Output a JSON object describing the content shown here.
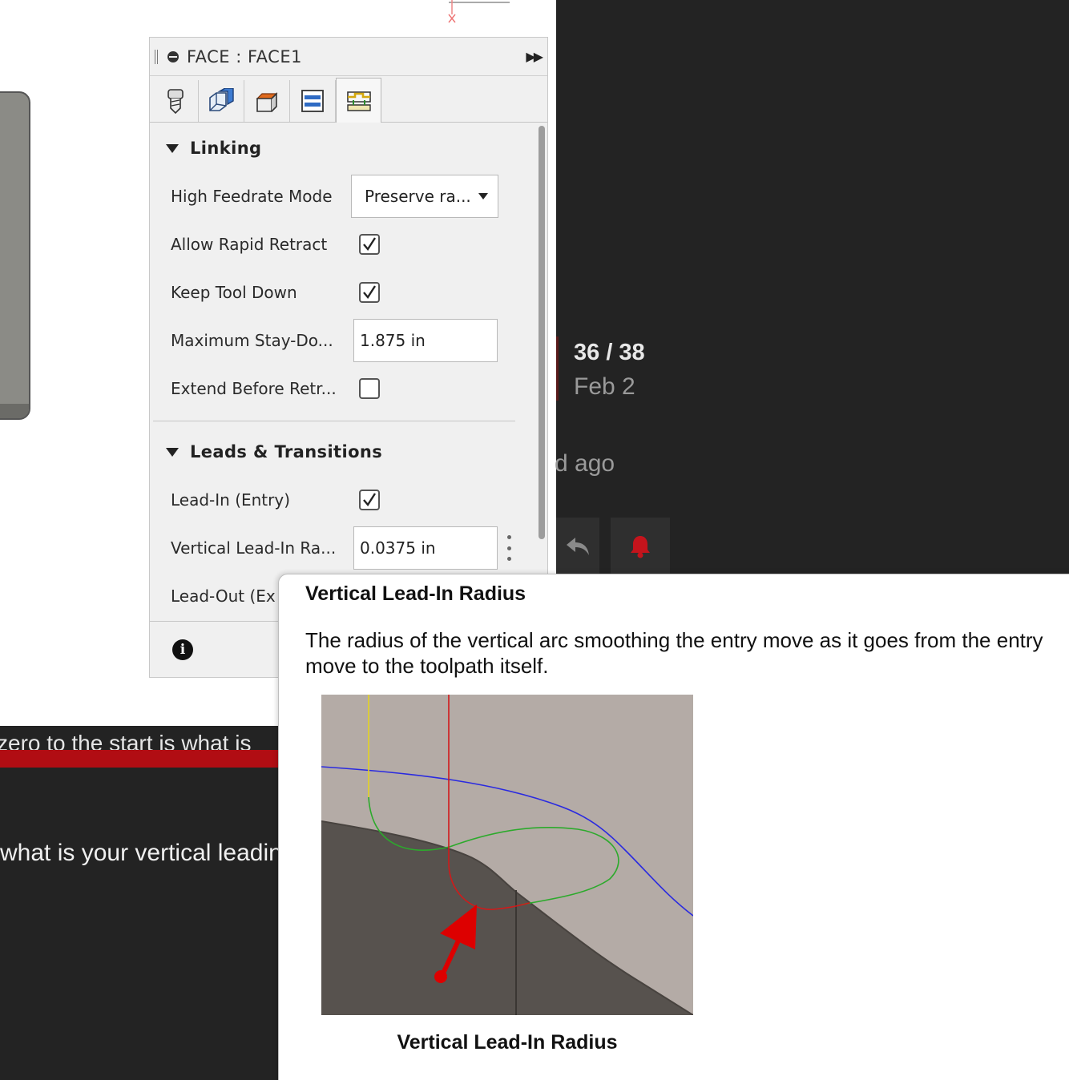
{
  "dialog": {
    "title": "FACE : FACE1",
    "tabs": [
      {
        "icon": "tool-icon",
        "active": false
      },
      {
        "icon": "geometry-icon",
        "active": false
      },
      {
        "icon": "heights-icon",
        "active": false
      },
      {
        "icon": "passes-icon",
        "active": false
      },
      {
        "icon": "linking-icon",
        "active": true
      }
    ],
    "sections": {
      "linking": {
        "title": "Linking",
        "high_feedrate_mode": {
          "label": "High Feedrate Mode",
          "value": "Preserve ra..."
        },
        "allow_rapid_retract": {
          "label": "Allow Rapid Retract",
          "checked": true
        },
        "keep_tool_down": {
          "label": "Keep Tool Down",
          "checked": true
        },
        "max_stay_down": {
          "label": "Maximum Stay-Do...",
          "value": "1.875 in"
        },
        "extend_before_retract": {
          "label": "Extend Before Retr...",
          "checked": false
        }
      },
      "leads": {
        "title": "Leads & Transitions",
        "lead_in": {
          "label": "Lead-In (Entry)",
          "checked": true
        },
        "vertical_lead_in_radius": {
          "label": "Vertical Lead-In Ra...",
          "value": "0.0375 in"
        },
        "lead_out": {
          "label": "Lead-Out (Ex"
        }
      }
    },
    "footer_icon": "info-icon"
  },
  "tooltip": {
    "title": "Vertical Lead-In Radius",
    "description": "The radius of the vertical arc smoothing the entry move as it goes from the entry move to the toolpath itself.",
    "caption": "Vertical Lead-In Radius"
  },
  "background": {
    "progress_count": "36 / 38",
    "progress_date": "Feb 2",
    "ago_text": "d ago",
    "cut_text_1": "zero to the start is what is",
    "cut_text_2": "what is your vertical leadin",
    "accent_red": "#b10d13"
  }
}
